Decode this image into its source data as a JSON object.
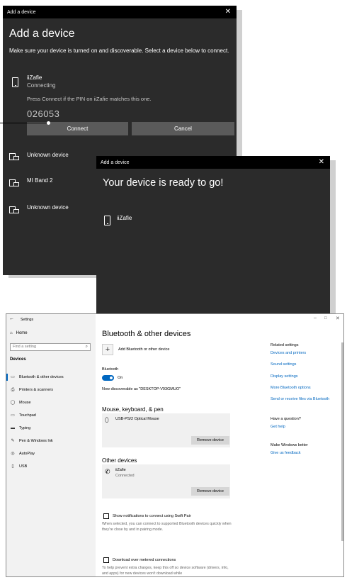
{
  "add_dialog": {
    "titlebar": "Add a device",
    "close": "✕",
    "heading": "Add a device",
    "subtext": "Make sure your device is turned on and discoverable. Select a device below to connect.",
    "device": {
      "name": "iiZafie",
      "status": "Connecting"
    },
    "pin_message": "Press Connect if the PIN on iiZafie matches this one.",
    "pin": "026053",
    "connect_label": "Connect",
    "cancel_label": "Cancel",
    "other_devices": [
      "Unknown device",
      "MI Band 2",
      "Unknown device"
    ]
  },
  "ready_dialog": {
    "titlebar": "Add a device",
    "close": "✕",
    "heading": "Your device is ready to go!",
    "device_name": "iiZafie"
  },
  "settings": {
    "back": "←",
    "title": "Settings",
    "window_controls": {
      "minimize": "–",
      "maximize": "□",
      "close": "✕"
    },
    "home": "Home",
    "search_placeholder": "Find a setting",
    "devices_header": "Devices",
    "nav": [
      {
        "label": "Bluetooth & other devices",
        "icon": "bluetooth-devices-icon"
      },
      {
        "label": "Printers & scanners",
        "icon": "printer-icon"
      },
      {
        "label": "Mouse",
        "icon": "mouse-icon"
      },
      {
        "label": "Touchpad",
        "icon": "touchpad-icon"
      },
      {
        "label": "Typing",
        "icon": "keyboard-icon"
      },
      {
        "label": "Pen & Windows Ink",
        "icon": "pen-icon"
      },
      {
        "label": "AutoPlay",
        "icon": "autoplay-icon"
      },
      {
        "label": "USB",
        "icon": "usb-icon"
      }
    ],
    "page_title": "Bluetooth & other devices",
    "add_label": "Add Bluetooth or other device",
    "bluetooth_label": "Bluetooth",
    "toggle_state": "On",
    "discoverable": "Now discoverable as \"DESKTOP-V93GMUO\"",
    "mouse_section": "Mouse, keyboard, & pen",
    "mouse_device": "USB-PS/2 Optical Mouse",
    "remove_label": "Remove device",
    "other_section": "Other devices",
    "other_device": {
      "name": "iiZafie",
      "status": "Connected"
    },
    "swift_pair_label": "Show notifications to connect using Swift Pair",
    "swift_pair_help": "When selected, you can connect to supported Bluetooth devices quickly when they're close by and in pairing mode.",
    "metered_label": "Download over metered connections",
    "metered_help": "To help prevent extra charges, keep this off so device software (drivers, info, and apps) for new devices won't download while",
    "related_header": "Related settings",
    "related_links": [
      "Devices and printers",
      "Sound settings",
      "Display settings",
      "More Bluetooth options",
      "Send or receive files via Bluetooth"
    ],
    "question_header": "Have a question?",
    "get_help": "Get help",
    "better_header": "Make Windows better",
    "feedback": "Give us feedback"
  }
}
